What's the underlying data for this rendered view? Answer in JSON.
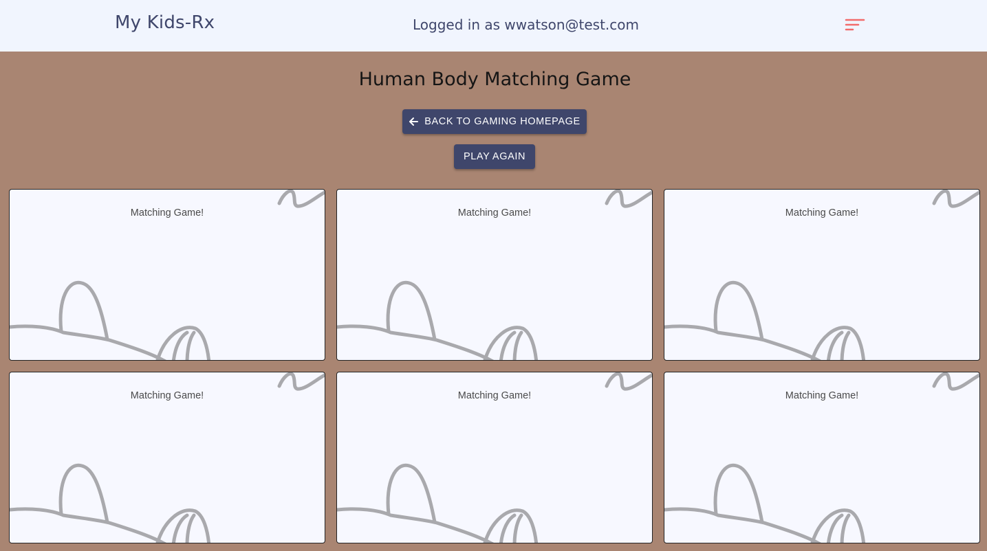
{
  "navbar": {
    "brand": "My Kids-Rx",
    "login_status": "Logged in as wwatson@test.com",
    "menu_icon": "sort-menu-icon",
    "menu_icon_color": "#f26b6b"
  },
  "page": {
    "title": "Human Body Matching Game",
    "back_button_label": "BACK TO GAMING HOMEPAGE",
    "back_icon": "arrow-left-icon",
    "play_again_label": "PLAY AGAIN"
  },
  "cards": [
    {
      "label": "Matching Game!"
    },
    {
      "label": "Matching Game!"
    },
    {
      "label": "Matching Game!"
    },
    {
      "label": "Matching Game!"
    },
    {
      "label": "Matching Game!"
    },
    {
      "label": "Matching Game!"
    }
  ],
  "colors": {
    "background": "#a98572",
    "navbar": "#f1f5fe",
    "button": "#3f466b",
    "card": "#f7f8ff"
  }
}
